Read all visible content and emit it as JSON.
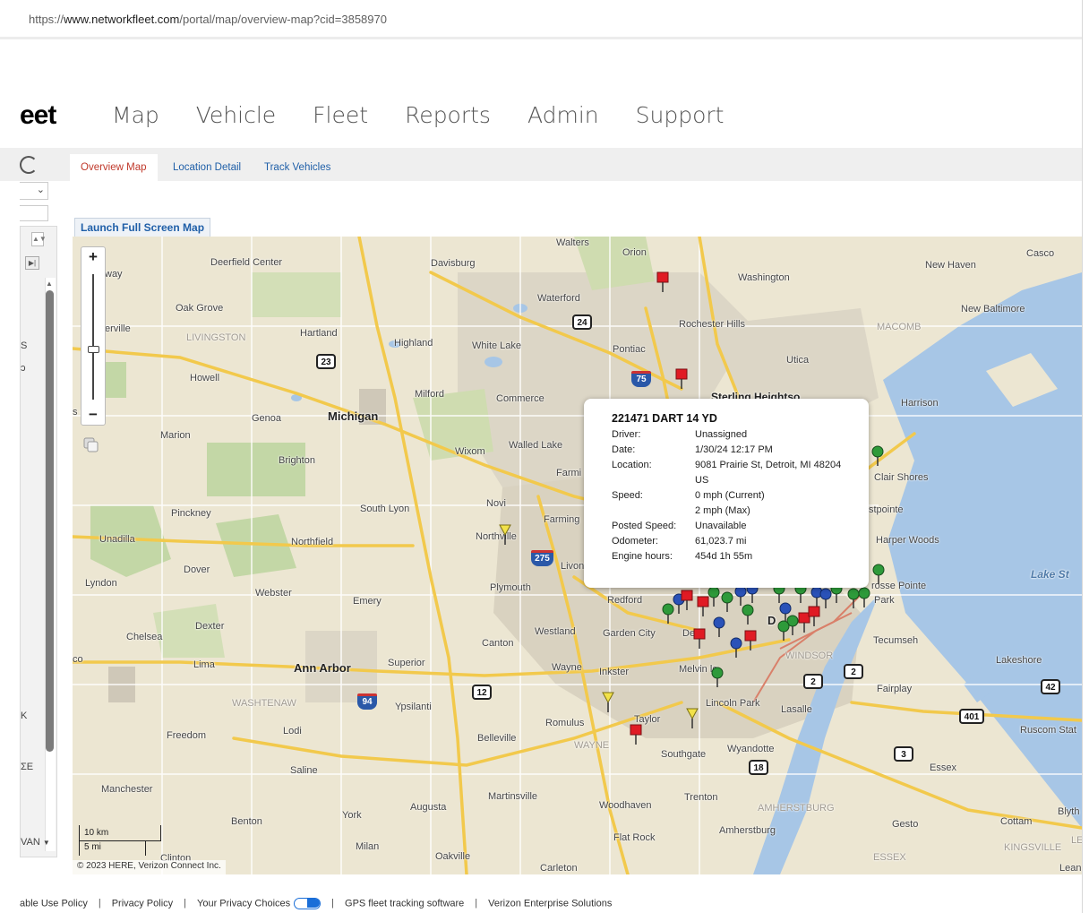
{
  "browser": {
    "url_prefix": "https://",
    "url_domain": "www.networkfleet.com",
    "url_path": "/portal/map/overview-map?cid=3858970"
  },
  "nav": {
    "logo": "eet",
    "items": [
      {
        "label": "Map"
      },
      {
        "label": "Vehicle"
      },
      {
        "label": "Fleet"
      },
      {
        "label": "Reports"
      },
      {
        "label": "Admin"
      },
      {
        "label": "Support"
      }
    ]
  },
  "tabs": [
    {
      "label": "Overview Map",
      "active": true
    },
    {
      "label": "Location Detail",
      "active": false
    },
    {
      "label": "Track Vehicles",
      "active": false
    }
  ],
  "sidebar": {
    "select_chevron": "⌄",
    "fragments": [
      "S",
      "ɔ",
      "K",
      "ΣE",
      "VAN"
    ]
  },
  "map": {
    "launch_button": "Launch Full Screen Map",
    "zoom_in": "+",
    "zoom_out": "−",
    "scale_km": "10 km",
    "scale_mi": "5 mi",
    "copyright": "© 2023 HERE, Verizon Connect Inc.",
    "labels": {
      "michigan": "Michigan",
      "ann_arbor": "Ann Arbor",
      "lake_st_clair": "Lake  St",
      "sterling_heights": "Sterling Heightso",
      "walters": "Walters",
      "orion": "Orion",
      "davisburg": "Davisburg",
      "deerfield_center": "Deerfield Center",
      "new_haven": "New Haven",
      "casco": "Casco",
      "washington": "Washington",
      "waterford": "Waterford",
      "new_baltimore": "New Baltimore",
      "oak_grove": "Oak Grove",
      "way": "way",
      "rochester_hills": "Rochester Hills",
      "macomb": "MACOMB",
      "erville": "erville",
      "livingston": "LIVINGSTON",
      "hartland": "Hartland",
      "highland": "Highland",
      "white_lake": "White Lake",
      "pontiac": "Pontiac",
      "utica": "Utica",
      "howell": "Howell",
      "milford": "Milford",
      "commerce": "Commerce",
      "harrison": "Harrison",
      "s_ers": "s   ers",
      "genoa": "Genoa",
      "marion": "Marion",
      "walled_lake": "Walled Lake",
      "wixom": "Wixom",
      "brighton": "Brighton",
      "farmi": "Farmi",
      "clair_shores": "Clair Shores",
      "novi": "Novi",
      "south_lyon": "South Lyon",
      "pinckney": "Pinckney",
      "farming": "Farming",
      "stpointe": "stpointe",
      "unadilla": "Unadilla",
      "northville": "Northville",
      "northfield": "Northfield",
      "harper_woods": "Harper Woods",
      "dover": "Dover",
      "livon": "Livon",
      "lyndon": "Lyndon",
      "webster": "Webster",
      "plymouth": "Plymouth",
      "grosse_pointe": "rosse Pointe",
      "park": "Park",
      "emery": "Emery",
      "redford": "Redford",
      "dexter": "Dexter",
      "chelsea": "Chelsea",
      "westland": "Westland",
      "garden_city": "Garden City",
      "dearborn": "De  b",
      "canton": "Canton",
      "tecumseh": "Tecumseh",
      "co": "co",
      "lima": "Lima",
      "superior": "Superior",
      "wayne": "Wayne",
      "inkster": "Inkster",
      "melvindale": "Melvin  le",
      "windsor": "WINDSOR",
      "lakeshore": "Lakeshore",
      "fairplay": "Fairplay",
      "washtenaw": "WASHTENAW",
      "ypsilanti": "Ypsilanti",
      "lincoln_park": "Lincoln Park",
      "lasalle": "Lasalle",
      "romulus": "Romulus",
      "taylor": "Taylor",
      "ruscom": "Ruscom Stat",
      "freedom": "Freedom",
      "lodi": "Lodi",
      "belleville": "Belleville",
      "wayne_county": "WAYNE",
      "wyandotte": "Wyandotte",
      "southgate": "Southgate",
      "saline": "Saline",
      "essex_town": "Essex",
      "manchester": "Manchester",
      "martinsville": "Martinsville",
      "trenton": "Trenton",
      "augusta": "Augusta",
      "woodhaven": "Woodhaven",
      "amherstburg_upper": "AMHERSTBURG",
      "york": "York",
      "benton": "Benton",
      "cottam": "Cottam",
      "gesto": "Gesto",
      "blyth": "Blyth",
      "amherstburg": "Amherstburg",
      "flat_rock": "Flat Rock",
      "kingsville": "KINGSVILLE",
      "le": "LE",
      "milan": "Milan",
      "oakville": "Oakville",
      "clinton": "Clinton",
      "carleton": "Carleton",
      "essex_county": "ESSEX",
      "d": "D",
      "lean": "Lean"
    },
    "shields": {
      "s24": "24",
      "s75": "75",
      "s23": "23",
      "s275": "275",
      "s94": "94",
      "s12": "12",
      "s2a": "2",
      "s2b": "2",
      "s42": "42",
      "s401": "401",
      "s3": "3",
      "s18": "18"
    }
  },
  "popup": {
    "title": "221471 DART 14 YD",
    "rows": [
      {
        "label": "Driver:",
        "value": "Unassigned"
      },
      {
        "label": "Date:",
        "value": "1/30/24 12:17 PM"
      },
      {
        "label": "Location:",
        "value": "9081 Prairie St, Detroit, MI 48204 US"
      },
      {
        "label": "Speed:",
        "value": "0 mph (Current)"
      },
      {
        "label": "",
        "value": "2 mph (Max)"
      },
      {
        "label": "Posted Speed:",
        "value": "Unavailable"
      },
      {
        "label": "Odometer:",
        "value": "61,023.7 mi"
      },
      {
        "label": "Engine hours:",
        "value": "454d 1h 55m"
      }
    ]
  },
  "footer": {
    "links": [
      "able Use Policy",
      "Privacy Policy",
      "Your Privacy Choices",
      "GPS fleet tracking software",
      "Verizon Enterprise Solutions"
    ]
  },
  "colors": {
    "accent_tab": "#c0392b",
    "link_blue": "#1f5fa8",
    "pin_red": "#e01b24",
    "pin_green": "#2e9a3a",
    "pin_blue": "#2a52b8",
    "pin_yellow": "#f2e24a"
  }
}
